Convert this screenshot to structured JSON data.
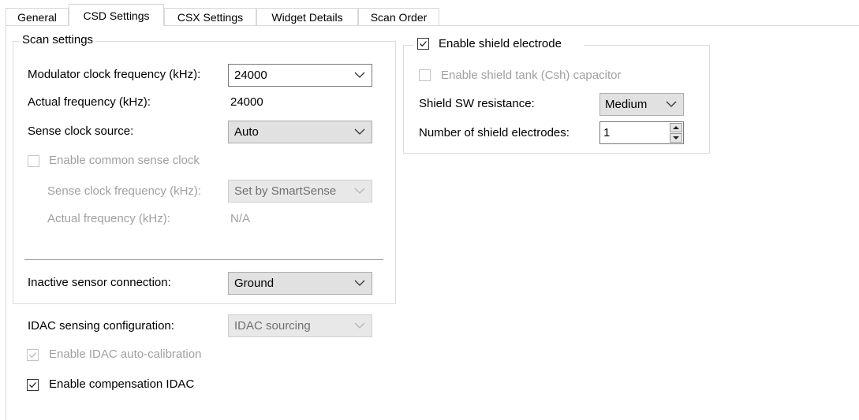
{
  "tabs": [
    {
      "label": "General"
    },
    {
      "label": "CSD Settings"
    },
    {
      "label": "CSX Settings"
    },
    {
      "label": "Widget Details"
    },
    {
      "label": "Scan Order"
    }
  ],
  "scan_settings": {
    "legend": "Scan settings",
    "modulator_label": "Modulator clock frequency (kHz):",
    "modulator_value": "24000",
    "actual_freq_label": "Actual frequency (kHz):",
    "actual_freq_value": "24000",
    "sense_source_label": "Sense clock source:",
    "sense_source_value": "Auto",
    "common_sense_label": "Enable common sense clock",
    "sense_freq_label": "Sense clock frequency (kHz):",
    "sense_freq_value": "Set by SmartSense",
    "actual_freq2_label": "Actual frequency (kHz):",
    "actual_freq2_value": "N/A",
    "inactive_label": "Inactive sensor connection:",
    "inactive_value": "Ground"
  },
  "idac": {
    "config_label": "IDAC sensing configuration:",
    "config_value": "IDAC sourcing",
    "auto_cal_label": "Enable IDAC auto-calibration",
    "compensation_label": "Enable compensation IDAC"
  },
  "shield": {
    "enable_label": "Enable shield electrode",
    "tank_label": "Enable shield tank (Csh) capacitor",
    "sw_label": "Shield SW resistance:",
    "sw_value": "Medium",
    "num_label": "Number of shield electrodes:",
    "num_value": "1"
  },
  "icons": {
    "dropdown": "chevron-down-icon",
    "check": "checkmark-icon",
    "spin_up": "triangle-up-icon",
    "spin_down": "triangle-down-icon"
  }
}
